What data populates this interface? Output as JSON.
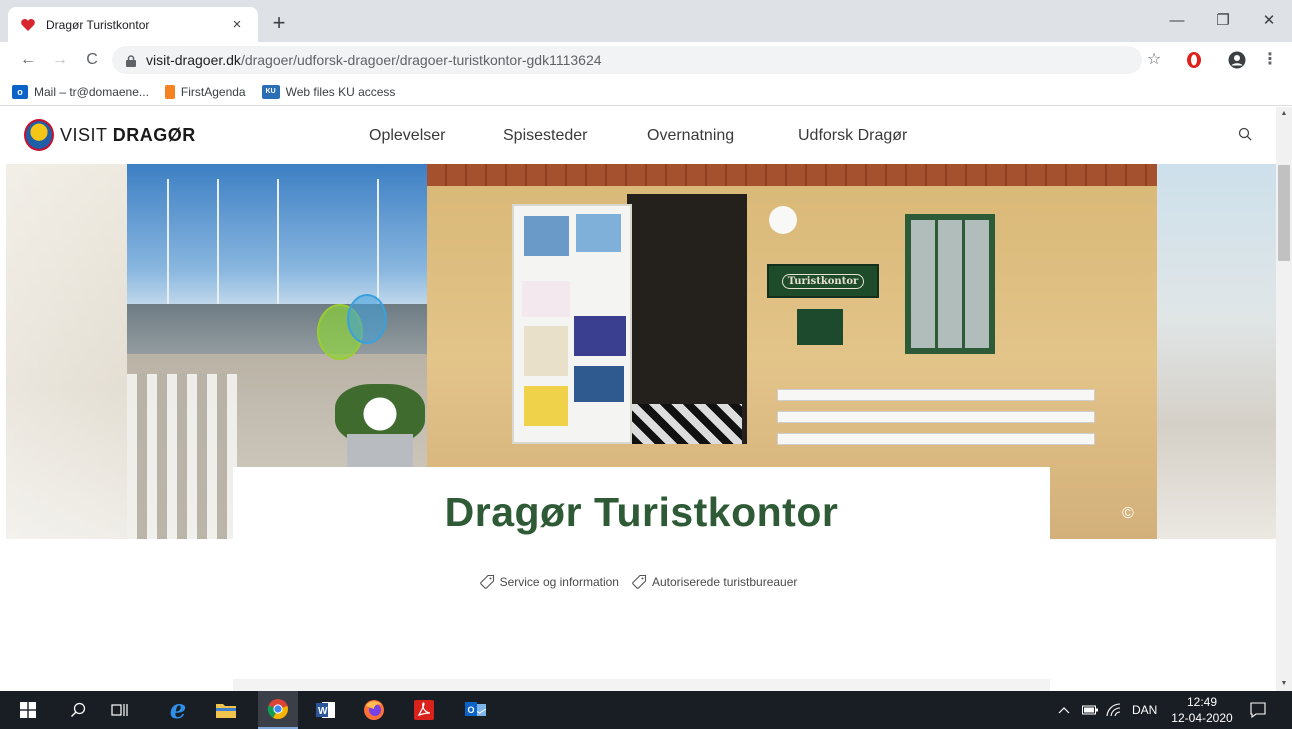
{
  "browser": {
    "tab": {
      "title": "Dragør Turistkontor",
      "close": "×"
    },
    "new_tab": "+",
    "window_controls": {
      "minimize": "—",
      "maximize": "❐",
      "close": "✕"
    },
    "nav": {
      "back": "←",
      "forward": "→",
      "reload": "C"
    },
    "url": {
      "host": "visit-dragoer.dk",
      "path": "/dragoer/udforsk-dragoer/dragoer-turistkontor-gdk1113624"
    },
    "toolbar_icons": {
      "star": "☆",
      "menu": "⋮"
    },
    "bookmarks": [
      {
        "label": "Mail – tr@domaene...",
        "icon": "outlook-icon"
      },
      {
        "label": "FirstAgenda",
        "icon": "firstagenda-icon"
      },
      {
        "label": "Web files KU access",
        "icon": "ku-icon"
      }
    ]
  },
  "site": {
    "logo": {
      "prefix": "VISIT",
      "name": "DRAGØR"
    },
    "nav": [
      "Oplevelser",
      "Spisesteder",
      "Overnatning",
      "Udforsk Dragør"
    ],
    "hero": {
      "sign_text": "Turistkontor",
      "copyright_symbol": "©"
    },
    "page_title": "Dragør Turistkontor",
    "tags": [
      "Service og information",
      "Autoriserede turistbureauer"
    ]
  },
  "taskbar": {
    "apps": [
      "windows-start",
      "search",
      "task-view",
      "internet-explorer",
      "file-explorer",
      "chrome",
      "word",
      "firefox",
      "acrobat",
      "outlook"
    ],
    "tray": {
      "chevron": "^",
      "language": "DAN"
    },
    "clock": {
      "time": "12:49",
      "date": "12-04-2020"
    }
  },
  "colors": {
    "accent_green": "#2e5a36",
    "tabstrip": "#dee1e6",
    "taskbar": "#191d24"
  }
}
